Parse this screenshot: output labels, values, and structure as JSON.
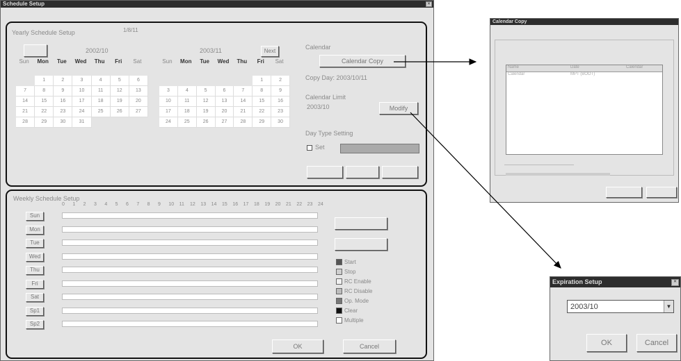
{
  "main_window": {
    "title": "Schedule Setup",
    "yearly": {
      "group_label": "Yearly Schedule Setup",
      "top_value": "1/8/11",
      "left_month": "2002/10",
      "right_month": "2003/11",
      "next_button": "Next",
      "weekdays": [
        "Sun",
        "Mon",
        "Tue",
        "Wed",
        "Thu",
        "Fri",
        "Sat"
      ],
      "left_days": [
        "",
        "1",
        "2",
        "3",
        "4",
        "5",
        "6",
        "7",
        "8",
        "9",
        "10",
        "11",
        "12",
        "13",
        "14",
        "15",
        "16",
        "17",
        "18",
        "19",
        "20",
        "21",
        "22",
        "23",
        "24",
        "25",
        "26",
        "27",
        "28",
        "29",
        "30",
        "31"
      ],
      "right_days": [
        "",
        "",
        "",
        "",
        "",
        "1",
        "2",
        "3",
        "4",
        "5",
        "6",
        "7",
        "8",
        "9",
        "10",
        "11",
        "12",
        "13",
        "14",
        "15",
        "16",
        "17",
        "18",
        "19",
        "20",
        "21",
        "22",
        "23",
        "24",
        "25",
        "26",
        "27",
        "28",
        "29",
        "30"
      ],
      "calendar_label": "Calendar",
      "calendar_copy_button": "Calendar Copy",
      "copy_day": "Copy Day: 2003/10/11",
      "calendar_limit_label": "Calendar Limit",
      "calendar_limit_value": "2003/10",
      "modify_button": "Modify",
      "day_type_label": "Day Type Setting",
      "day_type_checkbox": "Set"
    },
    "weekly": {
      "group_label": "Weekly Schedule Setup",
      "hours": [
        "0",
        "1",
        "2",
        "3",
        "4",
        "5",
        "6",
        "7",
        "8",
        "9",
        "10",
        "11",
        "12",
        "13",
        "14",
        "15",
        "16",
        "17",
        "18",
        "19",
        "20",
        "21",
        "22",
        "23",
        "24"
      ],
      "days": [
        "Sun",
        "Mon",
        "Tue",
        "Wed",
        "Thu",
        "Fri",
        "Sat",
        "Sp1",
        "Sp2"
      ],
      "legend": [
        "Start",
        "Stop",
        "RC Enable",
        "RC Disable",
        "Op. Mode",
        "Clear",
        "Multiple"
      ],
      "legend_colors": [
        "#555555",
        "#cfcfcf",
        "#f0f0f0",
        "#bdbdbd",
        "#777777",
        "#111111",
        "#ffffff"
      ],
      "ok_button": "OK",
      "cancel_button": "Cancel"
    }
  },
  "dialog_copy": {
    "title": "Calendar Copy",
    "col_headers": [
      "Name",
      "Date",
      "Calendar"
    ],
    "row": [
      "Calendar",
      "MPT (BOOT)"
    ]
  },
  "dialog_expiration": {
    "title": "Expiration Setup",
    "value": "2003/10",
    "ok_button": "OK",
    "cancel_button": "Cancel"
  }
}
